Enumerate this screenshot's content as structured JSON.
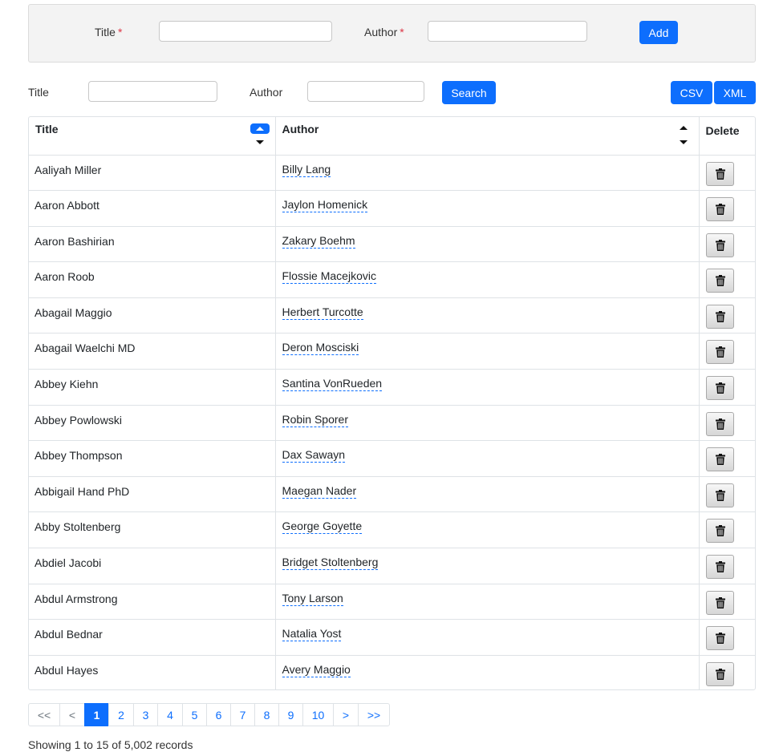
{
  "add_form": {
    "title_label": "Title",
    "author_label": "Author",
    "required_mark": "*",
    "title_value": "",
    "author_value": "",
    "add_label": "Add"
  },
  "search_form": {
    "title_label": "Title",
    "author_label": "Author",
    "title_value": "",
    "author_value": "",
    "search_label": "Search"
  },
  "export": {
    "csv_label": "CSV",
    "xml_label": "XML"
  },
  "table": {
    "headers": {
      "title": "Title",
      "author": "Author",
      "delete": "Delete"
    },
    "sort": {
      "column": "Title",
      "direction": "ascending"
    },
    "rows": [
      {
        "title": "Aaliyah Miller",
        "author": "Billy Lang"
      },
      {
        "title": "Aaron Abbott",
        "author": "Jaylon Homenick"
      },
      {
        "title": "Aaron Bashirian",
        "author": "Zakary Boehm"
      },
      {
        "title": "Aaron Roob",
        "author": "Flossie Macejkovic"
      },
      {
        "title": "Abagail Maggio",
        "author": "Herbert Turcotte"
      },
      {
        "title": "Abagail Waelchi MD",
        "author": "Deron Mosciski"
      },
      {
        "title": "Abbey Kiehn",
        "author": "Santina VonRueden"
      },
      {
        "title": "Abbey Powlowski",
        "author": "Robin Sporer"
      },
      {
        "title": "Abbey Thompson",
        "author": "Dax Sawayn"
      },
      {
        "title": "Abbigail Hand PhD",
        "author": "Maegan Nader"
      },
      {
        "title": "Abby Stoltenberg",
        "author": "George Goyette"
      },
      {
        "title": "Abdiel Jacobi",
        "author": "Bridget Stoltenberg"
      },
      {
        "title": "Abdul Armstrong",
        "author": "Tony Larson"
      },
      {
        "title": "Abdul Bednar",
        "author": "Natalia Yost"
      },
      {
        "title": "Abdul Hayes",
        "author": "Avery Maggio"
      }
    ],
    "delete_icon": "trash-icon"
  },
  "pagination": {
    "first": "<<",
    "prev": "<",
    "pages": [
      "1",
      "2",
      "3",
      "4",
      "5",
      "6",
      "7",
      "8",
      "9",
      "10"
    ],
    "active_page": "1",
    "next": ">",
    "last": ">>"
  },
  "status": {
    "records_text": "Showing 1 to 15 of 5,002 records"
  },
  "colors": {
    "accent": "#0d6efd",
    "required": "#dc3545",
    "panel": "#f3f3f3"
  }
}
